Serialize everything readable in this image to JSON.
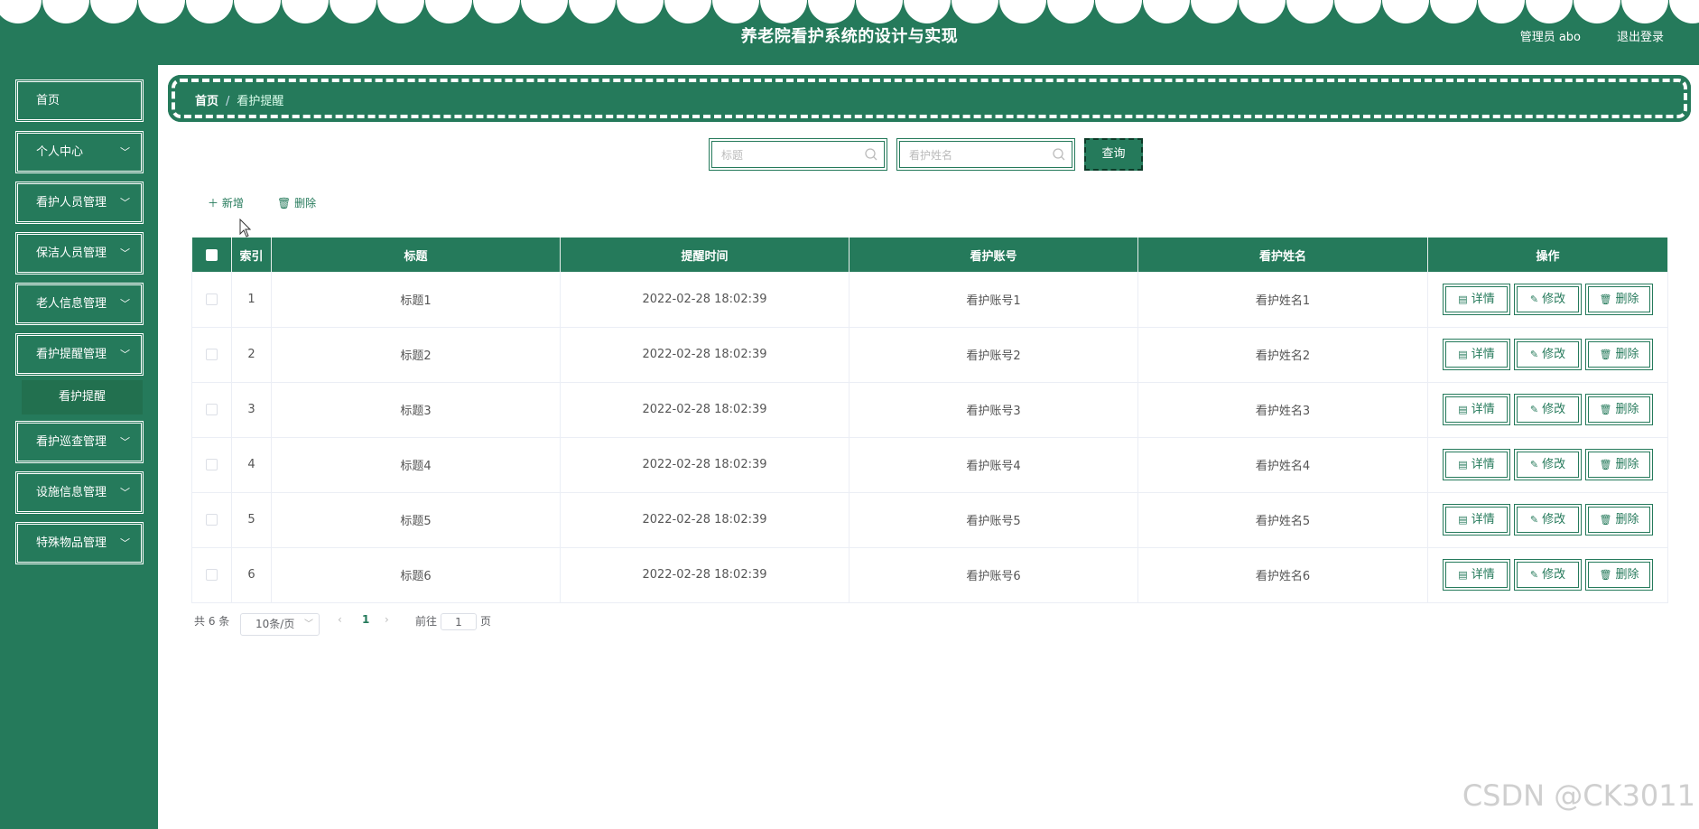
{
  "header": {
    "title": "养老院看护系统的设计与实现",
    "user_label": "管理员 abo",
    "logout": "退出登录"
  },
  "sidebar": {
    "items": [
      {
        "label": "首页",
        "expandable": false
      },
      {
        "label": "个人中心",
        "expandable": true
      },
      {
        "label": "看护人员管理",
        "expandable": true
      },
      {
        "label": "保洁人员管理",
        "expandable": true
      },
      {
        "label": "老人信息管理",
        "expandable": true
      },
      {
        "label": "看护提醒管理",
        "expandable": true
      },
      {
        "label": "看护巡查管理",
        "expandable": true
      },
      {
        "label": "设施信息管理",
        "expandable": true
      },
      {
        "label": "特殊物品管理",
        "expandable": true
      }
    ],
    "subitem": "看护提醒"
  },
  "breadcrumb": {
    "home": "首页",
    "separator": "/",
    "current": "看护提醒"
  },
  "search": {
    "title_placeholder": "标题",
    "name_placeholder": "看护姓名",
    "query_button": "查询"
  },
  "toolbar": {
    "add": "新增",
    "delete": "删除"
  },
  "table": {
    "columns": [
      "索引",
      "标题",
      "提醒时间",
      "看护账号",
      "看护姓名",
      "操作"
    ],
    "rows": [
      {
        "index": "1",
        "title": "标题1",
        "time": "2022-02-28 18:02:39",
        "account": "看护账号1",
        "name": "看护姓名1"
      },
      {
        "index": "2",
        "title": "标题2",
        "time": "2022-02-28 18:02:39",
        "account": "看护账号2",
        "name": "看护姓名2"
      },
      {
        "index": "3",
        "title": "标题3",
        "time": "2022-02-28 18:02:39",
        "account": "看护账号3",
        "name": "看护姓名3"
      },
      {
        "index": "4",
        "title": "标题4",
        "time": "2022-02-28 18:02:39",
        "account": "看护账号4",
        "name": "看护姓名4"
      },
      {
        "index": "5",
        "title": "标题5",
        "time": "2022-02-28 18:02:39",
        "account": "看护账号5",
        "name": "看护姓名5"
      },
      {
        "index": "6",
        "title": "标题6",
        "time": "2022-02-28 18:02:39",
        "account": "看护账号6",
        "name": "看护姓名6"
      }
    ],
    "actions": {
      "detail": "详情",
      "edit": "修改",
      "delete": "删除"
    }
  },
  "pagination": {
    "total": "共 6 条",
    "page_size": "10条/页",
    "current_page": "1",
    "goto_label": "前往",
    "goto_value": "1",
    "page_unit": "页"
  },
  "watermark": "CSDN @CK3011",
  "colors": {
    "primary": "#257a5b",
    "background": "#ffffff"
  }
}
